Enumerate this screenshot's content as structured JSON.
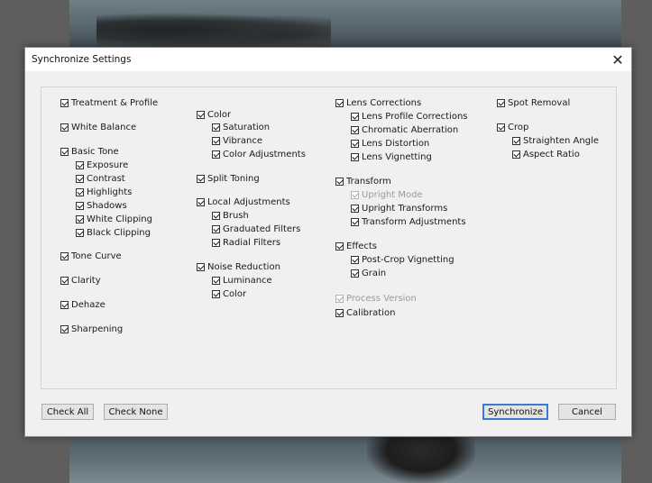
{
  "dialog": {
    "title": "Synchronize Settings",
    "close_glyph": "✕"
  },
  "options": {
    "col1": [
      {
        "label": "Treatment & Profile",
        "checked": true
      },
      {
        "label": "White Balance",
        "checked": true
      },
      {
        "label": "Basic Tone",
        "checked": true
      },
      {
        "label": "Exposure",
        "checked": true
      },
      {
        "label": "Contrast",
        "checked": true
      },
      {
        "label": "Highlights",
        "checked": true
      },
      {
        "label": "Shadows",
        "checked": true
      },
      {
        "label": "White Clipping",
        "checked": true
      },
      {
        "label": "Black Clipping",
        "checked": true
      },
      {
        "label": "Tone Curve",
        "checked": true
      },
      {
        "label": "Clarity",
        "checked": true
      },
      {
        "label": "Dehaze",
        "checked": true
      },
      {
        "label": "Sharpening",
        "checked": true
      }
    ],
    "col2": [
      {
        "label": "Color",
        "checked": true
      },
      {
        "label": "Saturation",
        "checked": true
      },
      {
        "label": "Vibrance",
        "checked": true
      },
      {
        "label": "Color Adjustments",
        "checked": true
      },
      {
        "label": "Split Toning",
        "checked": true
      },
      {
        "label": "Local Adjustments",
        "checked": true
      },
      {
        "label": "Brush",
        "checked": true
      },
      {
        "label": "Graduated Filters",
        "checked": true
      },
      {
        "label": "Radial Filters",
        "checked": true
      },
      {
        "label": "Noise Reduction",
        "checked": true
      },
      {
        "label": "Luminance",
        "checked": true
      },
      {
        "label": "Color",
        "checked": true
      }
    ],
    "col3": [
      {
        "label": "Lens Corrections",
        "checked": true
      },
      {
        "label": "Lens Profile Corrections",
        "checked": true
      },
      {
        "label": "Chromatic Aberration",
        "checked": true
      },
      {
        "label": "Lens Distortion",
        "checked": true
      },
      {
        "label": "Lens Vignetting",
        "checked": true
      },
      {
        "label": "Transform",
        "checked": true
      },
      {
        "label": "Upright Mode",
        "checked": true,
        "disabled": true
      },
      {
        "label": "Upright Transforms",
        "checked": true
      },
      {
        "label": "Transform Adjustments",
        "checked": true
      },
      {
        "label": "Effects",
        "checked": true
      },
      {
        "label": "Post-Crop Vignetting",
        "checked": true
      },
      {
        "label": "Grain",
        "checked": true
      },
      {
        "label": "Process Version",
        "checked": true,
        "disabled": true
      },
      {
        "label": "Calibration",
        "checked": true
      }
    ],
    "col4": [
      {
        "label": "Spot Removal",
        "checked": true
      },
      {
        "label": "Crop",
        "checked": true
      },
      {
        "label": "Straighten Angle",
        "checked": true
      },
      {
        "label": "Aspect Ratio",
        "checked": true
      }
    ]
  },
  "buttons": {
    "check_all": "Check All",
    "check_none": "Check None",
    "synchronize": "Synchronize",
    "cancel": "Cancel"
  },
  "colors": {
    "accent": "#3b7bd6",
    "dialog_bg": "#f0f0f0"
  }
}
